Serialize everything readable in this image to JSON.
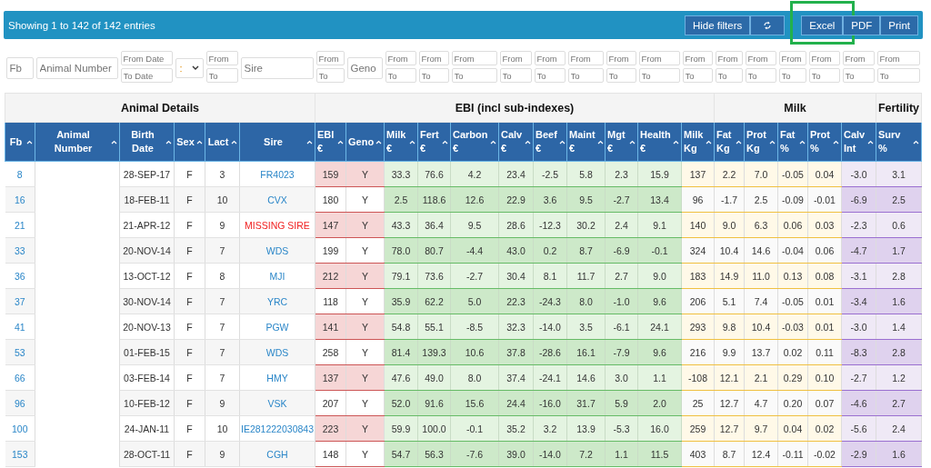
{
  "toolbar": {
    "summary": "Showing 1 to 142 of 142 entries",
    "buttons": [
      {
        "kind": "text",
        "label": "Hide filters",
        "highlighted": false
      },
      {
        "kind": "icon",
        "highlighted": false
      },
      {
        "kind": "text",
        "label": "Excel",
        "highlighted": true
      },
      {
        "kind": "text",
        "label": "PDF",
        "highlighted": false
      },
      {
        "kind": "text",
        "label": "Print",
        "highlighted": false
      }
    ]
  },
  "filters": [
    {
      "kind": "text",
      "placeholder": "Fb"
    },
    {
      "kind": "text",
      "placeholder": "Animal Number"
    },
    {
      "kind": "range",
      "fields": [
        {
          "placeholder": "From Date"
        },
        {
          "placeholder": "To Date"
        }
      ]
    },
    {
      "kind": "select",
      "value": ":"
    },
    {
      "kind": "range",
      "fields": [
        {
          "placeholder": "From"
        },
        {
          "placeholder": "To"
        }
      ]
    },
    {
      "kind": "text",
      "placeholder": "Sire"
    },
    {
      "kind": "range",
      "fields": [
        {
          "placeholder": "From"
        },
        {
          "placeholder": "To"
        }
      ]
    },
    {
      "kind": "text",
      "placeholder": "Geno"
    },
    {
      "kind": "range",
      "fields": [
        {
          "placeholder": "From"
        },
        {
          "placeholder": "To"
        }
      ]
    },
    {
      "kind": "range",
      "fields": [
        {
          "placeholder": "From"
        },
        {
          "placeholder": "To"
        }
      ]
    },
    {
      "kind": "range",
      "fields": [
        {
          "placeholder": "From"
        },
        {
          "placeholder": "To"
        }
      ]
    },
    {
      "kind": "range",
      "fields": [
        {
          "placeholder": "From"
        },
        {
          "placeholder": "To"
        }
      ]
    },
    {
      "kind": "range",
      "fields": [
        {
          "placeholder": "From"
        },
        {
          "placeholder": "To"
        }
      ]
    },
    {
      "kind": "range",
      "fields": [
        {
          "placeholder": "From"
        },
        {
          "placeholder": "To"
        }
      ]
    },
    {
      "kind": "range",
      "fields": [
        {
          "placeholder": "From"
        },
        {
          "placeholder": "To"
        }
      ]
    },
    {
      "kind": "range",
      "fields": [
        {
          "placeholder": "From"
        },
        {
          "placeholder": "To"
        }
      ]
    },
    {
      "kind": "range",
      "fields": [
        {
          "placeholder": "From"
        },
        {
          "placeholder": "To"
        }
      ]
    },
    {
      "kind": "range",
      "fields": [
        {
          "placeholder": "From"
        },
        {
          "placeholder": "To"
        }
      ]
    },
    {
      "kind": "range",
      "fields": [
        {
          "placeholder": "From"
        },
        {
          "placeholder": "To"
        }
      ]
    },
    {
      "kind": "range",
      "fields": [
        {
          "placeholder": "From"
        },
        {
          "placeholder": "To"
        }
      ]
    },
    {
      "kind": "range",
      "fields": [
        {
          "placeholder": "From"
        },
        {
          "placeholder": "To"
        }
      ]
    },
    {
      "kind": "range",
      "fields": [
        {
          "placeholder": "From"
        },
        {
          "placeholder": "To"
        }
      ]
    },
    {
      "kind": "range",
      "fields": [
        {
          "placeholder": "From"
        },
        {
          "placeholder": "To"
        }
      ]
    }
  ],
  "table": {
    "groups": [
      {
        "label": "Animal Details",
        "columns": [
          {
            "label": "Fb",
            "kind": "animal"
          },
          {
            "label": "Animal Number",
            "kind": "blank"
          },
          {
            "label": "Birth\nDate",
            "kind": "animal"
          },
          {
            "label": "Sex",
            "kind": "animal"
          },
          {
            "label": "Lact",
            "kind": "animal"
          },
          {
            "label": "Sire",
            "kind": "animal"
          }
        ]
      },
      {
        "label": "EBI (incl sub-indexes)",
        "columns": [
          {
            "label": "EBI\n€",
            "kind": "ebi"
          },
          {
            "label": "Geno",
            "kind": "ebi"
          },
          {
            "label": "Milk\n€",
            "kind": "sub"
          },
          {
            "label": "Fert\n€",
            "kind": "sub"
          },
          {
            "label": "Carbon\n€",
            "kind": "sub"
          },
          {
            "label": "Calv\n€",
            "kind": "sub"
          },
          {
            "label": "Beef\n€",
            "kind": "sub"
          },
          {
            "label": "Maint\n€",
            "kind": "sub"
          },
          {
            "label": "Mgt\n€",
            "kind": "sub"
          },
          {
            "label": "Health\n€",
            "kind": "sub"
          },
          {
            "label": "Milk\nKg",
            "kind": "milk"
          }
        ]
      },
      {
        "label": "Milk",
        "columns": [
          {
            "label": "Fat\nKg",
            "kind": "milk"
          },
          {
            "label": "Prot\nKg",
            "kind": "milk"
          },
          {
            "label": "Fat\n%",
            "kind": "milk"
          },
          {
            "label": "Prot\n%",
            "kind": "milk"
          },
          {
            "label": "Calv\nInt",
            "kind": "fert"
          }
        ]
      },
      {
        "label": "Fertility",
        "columns": [
          {
            "label": "Surv\n%",
            "kind": "fert"
          }
        ]
      }
    ],
    "rows": [
      {
        "fb": "8",
        "birth_date": "28-SEP-17",
        "sex": "F",
        "lact": "3",
        "sire": "FR4023",
        "sire_missing": false,
        "values": [
          "159",
          "Y",
          "33.3",
          "76.6",
          "4.2",
          "23.4",
          "-2.5",
          "5.8",
          "2.3",
          "15.9",
          "137",
          "2.2",
          "7.0",
          "-0.05",
          "0.04",
          "-3.0",
          "3.1"
        ]
      },
      {
        "fb": "16",
        "birth_date": "18-FEB-11",
        "sex": "F",
        "lact": "10",
        "sire": "CVX",
        "sire_missing": false,
        "values": [
          "180",
          "Y",
          "2.5",
          "118.6",
          "12.6",
          "22.9",
          "3.6",
          "9.5",
          "-2.7",
          "13.4",
          "96",
          "-1.7",
          "2.5",
          "-0.09",
          "-0.01",
          "-6.9",
          "2.5"
        ]
      },
      {
        "fb": "21",
        "birth_date": "21-APR-12",
        "sex": "F",
        "lact": "9",
        "sire": "MISSING SIRE",
        "sire_missing": true,
        "values": [
          "147",
          "Y",
          "43.3",
          "36.4",
          "9.5",
          "28.6",
          "-12.3",
          "30.2",
          "2.4",
          "9.1",
          "140",
          "9.0",
          "6.3",
          "0.06",
          "0.03",
          "-2.3",
          "0.6"
        ]
      },
      {
        "fb": "33",
        "birth_date": "20-NOV-14",
        "sex": "F",
        "lact": "7",
        "sire": "WDS",
        "sire_missing": false,
        "values": [
          "199",
          "Y",
          "78.0",
          "80.7",
          "-4.4",
          "43.0",
          "0.2",
          "8.7",
          "-6.9",
          "-0.1",
          "324",
          "10.4",
          "14.6",
          "-0.04",
          "0.06",
          "-4.7",
          "1.7"
        ]
      },
      {
        "fb": "36",
        "birth_date": "13-OCT-12",
        "sex": "F",
        "lact": "8",
        "sire": "MJI",
        "sire_missing": false,
        "values": [
          "212",
          "Y",
          "79.1",
          "73.6",
          "-2.7",
          "30.4",
          "8.1",
          "11.7",
          "2.7",
          "9.0",
          "183",
          "14.9",
          "11.0",
          "0.13",
          "0.08",
          "-3.1",
          "2.8"
        ]
      },
      {
        "fb": "37",
        "birth_date": "30-NOV-14",
        "sex": "F",
        "lact": "7",
        "sire": "YRC",
        "sire_missing": false,
        "values": [
          "118",
          "Y",
          "35.9",
          "62.2",
          "5.0",
          "22.3",
          "-24.3",
          "8.0",
          "-1.0",
          "9.6",
          "206",
          "5.1",
          "7.4",
          "-0.05",
          "0.01",
          "-3.4",
          "1.6"
        ]
      },
      {
        "fb": "41",
        "birth_date": "20-NOV-13",
        "sex": "F",
        "lact": "7",
        "sire": "PGW",
        "sire_missing": false,
        "values": [
          "141",
          "Y",
          "54.8",
          "55.1",
          "-8.5",
          "32.3",
          "-14.0",
          "3.5",
          "-6.1",
          "24.1",
          "293",
          "9.8",
          "10.4",
          "-0.03",
          "0.01",
          "-3.0",
          "1.4"
        ]
      },
      {
        "fb": "53",
        "birth_date": "01-FEB-15",
        "sex": "F",
        "lact": "7",
        "sire": "WDS",
        "sire_missing": false,
        "values": [
          "258",
          "Y",
          "81.4",
          "139.3",
          "10.6",
          "37.8",
          "-28.6",
          "16.1",
          "-7.9",
          "9.6",
          "216",
          "9.9",
          "13.7",
          "0.02",
          "0.11",
          "-8.3",
          "2.8"
        ]
      },
      {
        "fb": "66",
        "birth_date": "03-FEB-14",
        "sex": "F",
        "lact": "7",
        "sire": "HMY",
        "sire_missing": false,
        "values": [
          "137",
          "Y",
          "47.6",
          "49.0",
          "8.0",
          "37.4",
          "-24.1",
          "14.6",
          "3.0",
          "1.1",
          "-108",
          "12.1",
          "2.1",
          "0.29",
          "0.10",
          "-2.7",
          "1.2"
        ]
      },
      {
        "fb": "96",
        "birth_date": "10-FEB-12",
        "sex": "F",
        "lact": "9",
        "sire": "VSK",
        "sire_missing": false,
        "values": [
          "207",
          "Y",
          "52.0",
          "91.6",
          "15.6",
          "24.4",
          "-16.0",
          "31.7",
          "5.9",
          "2.0",
          "25",
          "12.7",
          "4.7",
          "0.20",
          "0.07",
          "-4.6",
          "2.7"
        ]
      },
      {
        "fb": "100",
        "birth_date": "24-JAN-11",
        "sex": "F",
        "lact": "10",
        "sire": "IE281222030843",
        "sire_missing": false,
        "values": [
          "223",
          "Y",
          "59.9",
          "100.0",
          "-0.1",
          "35.2",
          "3.2",
          "13.9",
          "-5.3",
          "16.0",
          "259",
          "12.7",
          "9.7",
          "0.04",
          "0.02",
          "-5.6",
          "2.4"
        ]
      },
      {
        "fb": "153",
        "birth_date": "28-OCT-11",
        "sex": "F",
        "lact": "9",
        "sire": "CGH",
        "sire_missing": false,
        "values": [
          "148",
          "Y",
          "54.7",
          "56.3",
          "-7.6",
          "39.0",
          "-14.0",
          "7.2",
          "1.1",
          "11.5",
          "403",
          "8.7",
          "12.4",
          "-0.11",
          "-0.02",
          "-2.9",
          "1.6"
        ]
      }
    ]
  }
}
